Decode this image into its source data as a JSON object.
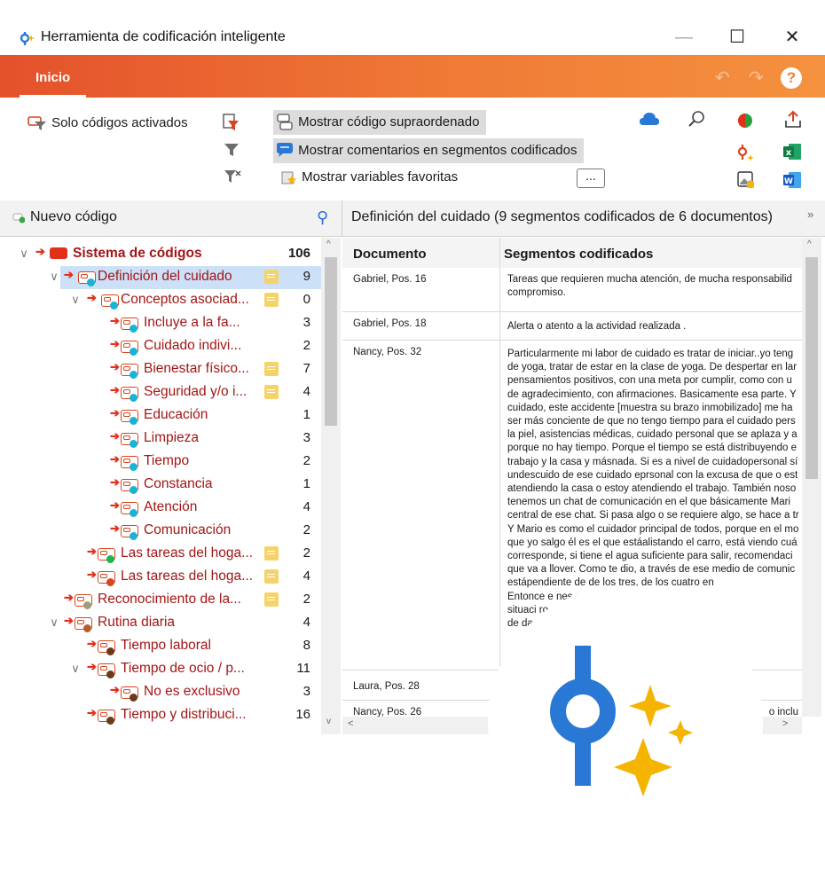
{
  "window": {
    "title": "Herramienta de codificación inteligente"
  },
  "ribbon": {
    "tab": "Inicio",
    "only_active": "Solo códigos activados",
    "show_parent": "Mostrar código supraordenado",
    "show_comments": "Mostrar comentarios en segmentos codificados",
    "show_favorites": "Mostrar variables favoritas",
    "more": "..."
  },
  "left_pane": {
    "new_code": "Nuevo código",
    "rows": [
      {
        "label": "Sistema de códigos",
        "count": "106"
      },
      {
        "label": "Definición del cuidado",
        "count": "9"
      },
      {
        "label": "Conceptos asociad...",
        "count": "0"
      },
      {
        "label": "Incluye a la fa...",
        "count": "3"
      },
      {
        "label": "Cuidado indivi...",
        "count": "2"
      },
      {
        "label": "Bienestar físico...",
        "count": "7"
      },
      {
        "label": "Seguridad y/o i...",
        "count": "4"
      },
      {
        "label": "Educación",
        "count": "1"
      },
      {
        "label": "Limpieza",
        "count": "3"
      },
      {
        "label": "Tiempo",
        "count": "2"
      },
      {
        "label": "Constancia",
        "count": "1"
      },
      {
        "label": "Atención",
        "count": "4"
      },
      {
        "label": "Comunicación",
        "count": "2"
      },
      {
        "label": "Las tareas del hoga...",
        "count": "2"
      },
      {
        "label": "Las tareas del hoga...",
        "count": "4"
      },
      {
        "label": "Reconocimiento de la...",
        "count": "2"
      },
      {
        "label": "Rutina diaria",
        "count": "4"
      },
      {
        "label": "Tiempo laboral",
        "count": "8"
      },
      {
        "label": "Tiempo de ocio / p...",
        "count": "11"
      },
      {
        "label": "No es exclusivo",
        "count": "3"
      },
      {
        "label": "Tiempo y distribuci...",
        "count": "16"
      }
    ]
  },
  "right_pane": {
    "title": "Definición del cuidado (9 segmentos codificados de 6 documentos)",
    "col_document": "Documento",
    "col_segments": "Segmentos codificados",
    "rows": [
      {
        "doc": "Gabriel, Pos. 16",
        "lines": [
          "Tareas que requieren mucha atención, de mucha responsabilid",
          "compromiso."
        ]
      },
      {
        "doc": "Gabriel, Pos. 18",
        "lines": [
          "Alerta o atento a la actividad realizada ."
        ]
      },
      {
        "doc": "Nancy, Pos. 32",
        "lines": [
          "Particularmente mi labor de cuidado es tratar de iniciar..yo teng",
          "de yoga, tratar de estar en la clase de yoga. De despertar en lar",
          "pensamientos positivos, con una meta por cumplir, como con u",
          "de agradecimiento, con afirmaciones. Basicamente esa parte. Y",
          "cuidado, este accidente [muestra su brazo inmobilizado] me ha",
          "ser más conciente de que no tengo tiempo para el cuidado pers",
          "la piel, asistencias médicas, cuidado personal que se aplaza y a",
          "porque no hay tiempo. Porque el tiempo se está distribuyendo e",
          "trabajo y la casa y másnada. Si es a nivel de cuidadopersonal sí",
          "undescuido de ese cuidado eprsonal con la excusa de que o est",
          "atendiendo la casa o estoy atendiendo el trabajo. También noso",
          "tenemos un chat de comunicación en el que básicamente Mari",
          "central de ese chat. Si pasa algo o se requiere algo, se hace a tr",
          "Y Mario es como el cuidador principal de todos, porque en el mo",
          "que yo salgo él es el que estáalistando el carro, está viendo cuá",
          "corresponde, si tiene el agua suficiente para salir, recomendaci",
          "que va a llover. Como te dio, a través de ese medio de comunic",
          "estápendiente de                de los tres, de los cuatro en",
          "Entonce e                          nes a nivel de tráfico,",
          "situaci                              ro desplazarse, n",
          "de                                     dador general"
        ]
      },
      {
        "doc": "Laura, Pos. 28",
        "lines": []
      },
      {
        "doc": "Nancy, Pos. 26",
        "lines": [
          "o inclu"
        ]
      }
    ]
  }
}
